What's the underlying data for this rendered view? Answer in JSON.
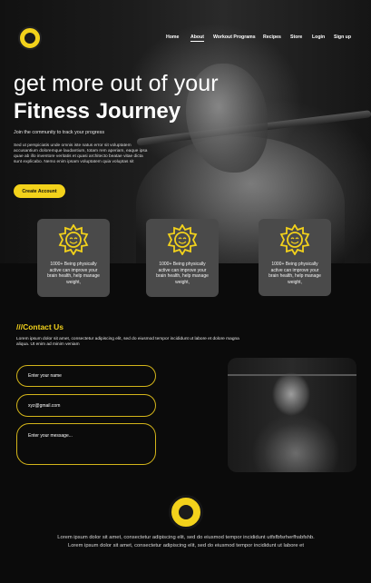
{
  "header": {
    "logo_icon": "gym-logo-icon",
    "nav": [
      {
        "label": "Home"
      },
      {
        "label": "About",
        "active": true
      },
      {
        "label": "Workout Programs"
      },
      {
        "label": "Recipes"
      },
      {
        "label": "Store"
      },
      {
        "label": "Login"
      },
      {
        "label": "Sign up"
      }
    ]
  },
  "hero": {
    "title_line1": "get more out of your",
    "title_line2": "Fitness Journey",
    "subtitle": "Join the community to track your progress",
    "body": "Sed ut perspiciatis unde omnis iste natus error sit voluptatem accusantium doloremque laudantium, totam rem aperiam, eaque ipsa quae ab illo inventore veritatis et quasi architecto beatae vitae dicta sunt explicabo. Nemo enim ipsam voluptatem quia voluptas sit",
    "cta_label": "Create Account"
  },
  "features": [
    {
      "icon": "smiley-sun-icon",
      "text": "1000+ Being physically active can improve your brain health, help manage weight,"
    },
    {
      "icon": "smiley-sun-icon",
      "text": "1000+ Being physically active can improve your brain health, help manage weight,"
    },
    {
      "icon": "smiley-sun-icon",
      "text": "1000+ Being physically active can improve your brain health, help manage weight,"
    }
  ],
  "contact": {
    "title": "///Contact Us",
    "body": "Lorem ipsum dolor sit amet, consectetur adipiscing elit, sed do eiusmod tempor incididunt ut labore et dolore magna aliqua. Ut enim ad minim veniam",
    "name_placeholder": "Enter your name",
    "email_value": "xyz@gmail.com",
    "message_placeholder": "Enter your message..."
  },
  "footer": {
    "logo_icon": "gym-logo-icon",
    "text": "Lorem ipsum dolor sit amet, consectetur adipiscing elit, sed do eiusmod tempor incididunt utfsfbfsrherfhsbfshb. Lorem ipsum dolor sit amet, consectetur adipiscing elit, sed do eiusmod tempor incididunt ut labore et"
  },
  "colors": {
    "accent": "#f3d21b",
    "background": "#0b0b0b",
    "card": "#4a4a4a"
  }
}
